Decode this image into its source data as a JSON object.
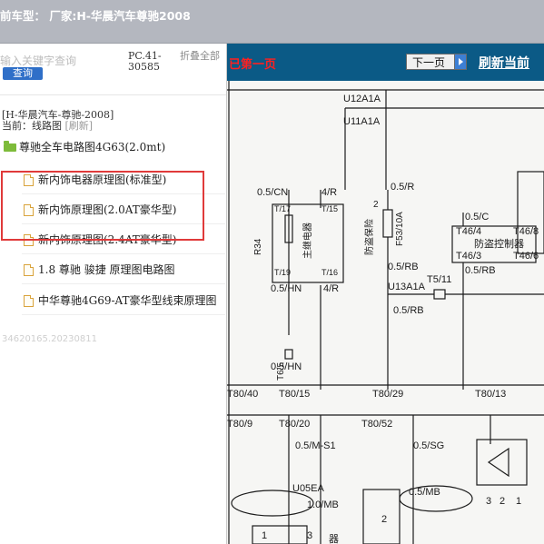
{
  "header": {
    "title": "前车型：  厂家:H-华晨汽车尊驰2008"
  },
  "left_panel": {
    "search_placeholder": "输入关键字查询",
    "query_button": "查询",
    "code": "PC.41-30585",
    "fold_all": "折叠全部",
    "vehicle_label": "[H-华晨汽车-尊驰-2008]",
    "current_label": "当前：线路图",
    "refresh_label": "[刷新]",
    "tree_root": "尊驰全车电路图4G63(2.0mt)",
    "items": [
      {
        "label": "新内饰电器原理图(标准型)"
      },
      {
        "label": "新内饰原理图(2.0AT豪华型)"
      },
      {
        "label": "新内饰原理图(2.4AT豪华型)"
      },
      {
        "label": "1.8 尊驰 骏捷 原理图电路图"
      },
      {
        "label": "中华尊驰4G69-AT豪华型线束原理图"
      }
    ],
    "version": "34620165.20230811"
  },
  "viewer": {
    "prev_label": "已第一页",
    "next_button": "下一页",
    "refresh_link": "刷新当前",
    "labels": {
      "u12a1a": "U12A1A",
      "u11a1a": "U11A1A",
      "w05cn": "0.5/CN",
      "r4": "4/R",
      "t17": "T/17",
      "t15": "T/15",
      "relay": "主继电器",
      "r34": "R34",
      "t19": "T/19",
      "t16": "T/16",
      "w05hn": "0.5/HN",
      "r4b": "4/R",
      "fuse_num": "2",
      "fuse": "防盗保险",
      "f53": "F53/10A",
      "w05r": "0.5/R",
      "w05rb": "0.5/RB",
      "t511": "T5/11",
      "u13a1a": "U13A1A",
      "w05rb2": "0.5/RB",
      "w05c": "0.5/C",
      "t464": "T46/4",
      "t468": "T46/8",
      "controller": "防盗控制器",
      "t463": "T46/3",
      "t466": "T46/6",
      "w05rb3": "0.5/RB",
      "t65": "T6/5",
      "w05hn2": "0.5/HN",
      "t8040": "T80/40",
      "t8015": "T80/15",
      "t8029": "T80/29",
      "t8013": "T80/13",
      "t809": "T80/9",
      "t8020": "T80/20",
      "t8052": "T80/52",
      "w05ms1": "0.5/M-S1",
      "w05sg": "0.5/SG",
      "u05ea": "U05EA",
      "w05mb": "0.5/MB",
      "w10mb": "1.0/MB",
      "n1": "1",
      "n3": "3",
      "n2": "2",
      "n32": "3",
      "n22": "2",
      "n12": "1",
      "device": "器"
    }
  }
}
